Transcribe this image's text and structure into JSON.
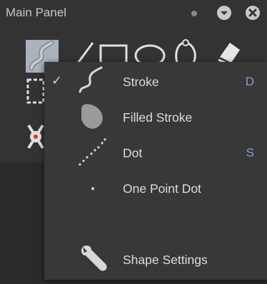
{
  "panel": {
    "title": "Main Panel"
  },
  "tools": [
    "pen-tool-icon",
    "line-tool-icon",
    "rectangle-tool-icon",
    "ellipse-tool-icon",
    "lasso-tool-icon",
    "eraser-tool-icon",
    "selection-tool-icon",
    "bone-tool-icon"
  ],
  "menu": {
    "items": [
      {
        "label": "Stroke",
        "shortcut": "D",
        "checked": true,
        "icon": "stroke-icon"
      },
      {
        "label": "Filled Stroke",
        "shortcut": "",
        "checked": false,
        "icon": "filled-stroke-icon"
      },
      {
        "label": "Dot",
        "shortcut": "S",
        "checked": false,
        "icon": "dot-line-icon"
      },
      {
        "label": "One Point Dot",
        "shortcut": "",
        "checked": false,
        "icon": "single-dot-icon"
      },
      {
        "label": "Shape Settings",
        "shortcut": "",
        "checked": false,
        "icon": "wrench-icon"
      }
    ]
  },
  "colors": {
    "panel_bg": "#333333",
    "menu_bg": "#383838",
    "text": "#dcdcdc",
    "shortcut": "#8a9fd0",
    "accent_red": "#d23a2e"
  }
}
